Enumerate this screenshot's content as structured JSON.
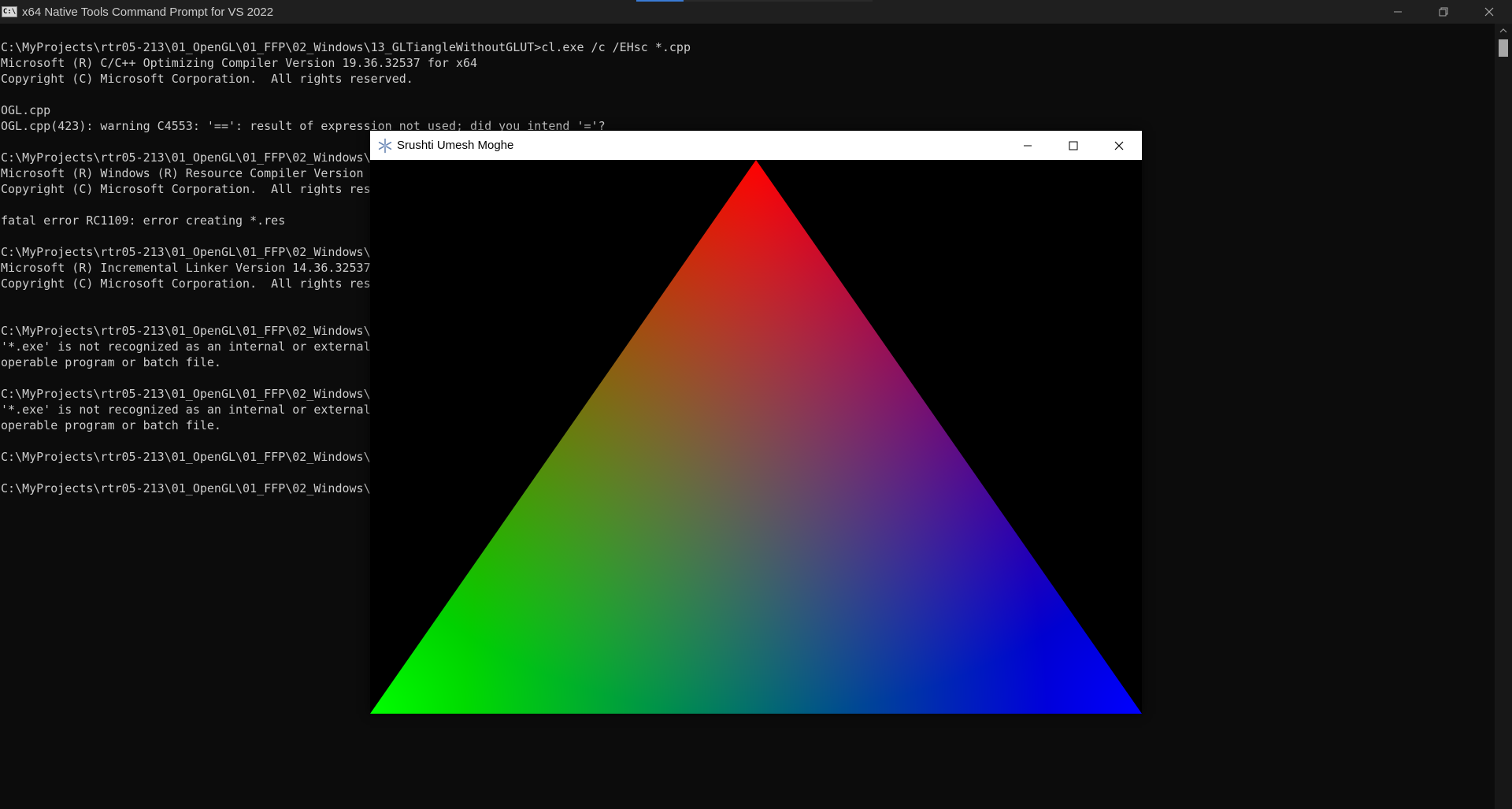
{
  "console": {
    "title": "x64 Native Tools Command Prompt for VS 2022",
    "app_icon_text": "C:\\",
    "lines": [
      "C:\\MyProjects\\rtr05-213\\01_OpenGL\\01_FFP\\02_Windows\\13_GLTiangleWithoutGLUT>cl.exe /c /EHsc *.cpp",
      "Microsoft (R) C/C++ Optimizing Compiler Version 19.36.32537 for x64",
      "Copyright (C) Microsoft Corporation.  All rights reserved.",
      "",
      "OGL.cpp",
      "OGL.cpp(423): warning C4553: '==': result of expression not used; did you intend '='?",
      "",
      "C:\\MyProjects\\rtr05-213\\01_OpenGL\\01_FFP\\02_Windows\\",
      "Microsoft (R) Windows (R) Resource Compiler Version",
      "Copyright (C) Microsoft Corporation.  All rights res",
      "",
      "fatal error RC1109: error creating *.res",
      "",
      "C:\\MyProjects\\rtr05-213\\01_OpenGL\\01_FFP\\02_Windows\\",
      "Microsoft (R) Incremental Linker Version 14.36.32537",
      "Copyright (C) Microsoft Corporation.  All rights res",
      "",
      "",
      "C:\\MyProjects\\rtr05-213\\01_OpenGL\\01_FFP\\02_Windows\\",
      "'*.exe' is not recognized as an internal or external",
      "operable program or batch file.",
      "",
      "C:\\MyProjects\\rtr05-213\\01_OpenGL\\01_FFP\\02_Windows\\",
      "'*.exe' is not recognized as an internal or external",
      "operable program or batch file.",
      "",
      "C:\\MyProjects\\rtr05-213\\01_OpenGL\\01_FFP\\02_Windows\\",
      "",
      "C:\\MyProjects\\rtr05-213\\01_OpenGL\\01_FFP\\02_Windows\\"
    ],
    "icons": {
      "minimize": "minimize-icon",
      "restore": "restore-icon",
      "close": "close-icon"
    }
  },
  "gl_window": {
    "title": "Srushti Umesh Moghe",
    "icons": {
      "app": "snowflake-icon",
      "minimize": "minimize-icon",
      "maximize": "maximize-icon",
      "close": "close-icon"
    },
    "triangle_colors": {
      "top": "#ff0000",
      "bottom_left": "#00ff00",
      "bottom_right": "#0000ff"
    },
    "background": "#000000"
  }
}
